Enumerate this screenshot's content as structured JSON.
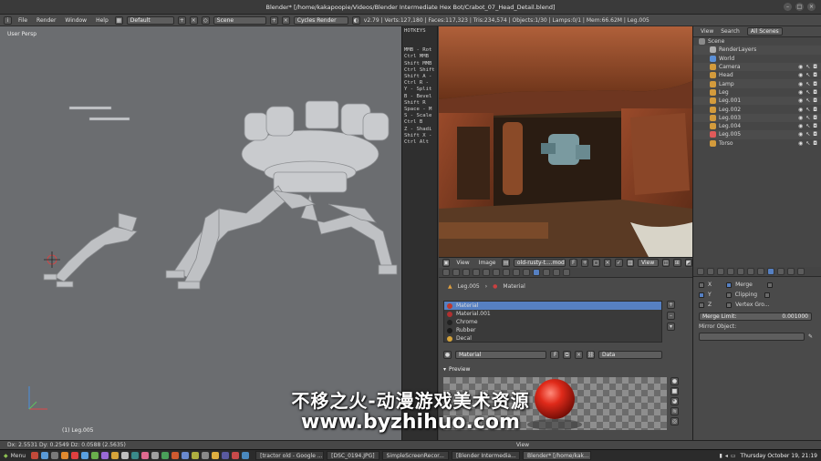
{
  "window": {
    "title": "Blender* [/home/kakapoopie/Videos/Blender Intermediate Hex Bot/Crabot_07_Head_Detail.blend]"
  },
  "infobar": {
    "menus": [
      "File",
      "Render",
      "Window",
      "Help"
    ],
    "layout": "Default",
    "scene": "Scene",
    "engine": "Cycles Render",
    "stats": "v2.79 | Verts:127,180 | Faces:117,323 | Tris:234,574 | Objects:1/30 | Lamps:0/1 | Mem:66.62M | Leg.005"
  },
  "viewport": {
    "view_label": "User Persp",
    "object_label": "(1) Leg.005"
  },
  "hotkeys": {
    "title": "HOTKEYS",
    "lines": [
      "MMB - Rot",
      "Ctrl MMB",
      "Shift MMB",
      "Ctrl Shift",
      "Shift A -",
      "Ctrl R -",
      "Y - Split",
      "B - Bevel",
      "Shift R",
      "Space - M",
      "S - Scale",
      "Ctrl B",
      "Z - Shadi",
      "Shift X -",
      "Ctrl Alt"
    ]
  },
  "image_header": {
    "menus": [
      "View",
      "Image"
    ],
    "image_name": "old-rusty-t....model.jpg",
    "view_btn": "View"
  },
  "outliner": {
    "tabs": [
      "View",
      "Search",
      "All Scenes"
    ],
    "items": [
      {
        "label": "Scene",
        "indent": 0,
        "color": "#8a8a8a",
        "vis": false
      },
      {
        "label": "RenderLayers",
        "indent": 1,
        "color": "#b0b0b0",
        "vis": false
      },
      {
        "label": "World",
        "indent": 1,
        "color": "#5b8fd6",
        "vis": false
      },
      {
        "label": "Camera",
        "indent": 1,
        "color": "#d39b3c",
        "vis": true
      },
      {
        "label": "Head",
        "indent": 1,
        "color": "#d39b3c",
        "vis": true
      },
      {
        "label": "Lamp",
        "indent": 1,
        "color": "#d39b3c",
        "vis": true
      },
      {
        "label": "Leg",
        "indent": 1,
        "color": "#d39b3c",
        "vis": true
      },
      {
        "label": "Leg.001",
        "indent": 1,
        "color": "#d39b3c",
        "vis": true
      },
      {
        "label": "Leg.002",
        "indent": 1,
        "color": "#d39b3c",
        "vis": true
      },
      {
        "label": "Leg.003",
        "indent": 1,
        "color": "#d39b3c",
        "vis": true
      },
      {
        "label": "Leg.004",
        "indent": 1,
        "color": "#d39b3c",
        "vis": true
      },
      {
        "label": "Leg.005",
        "indent": 1,
        "color": "#e05a5a",
        "vis": true
      },
      {
        "label": "Torso",
        "indent": 1,
        "color": "#d39b3c",
        "vis": true
      }
    ]
  },
  "material_props": {
    "object": "Leg.005",
    "context": "Material",
    "slots": [
      {
        "name": "Material",
        "color": "#c0392b",
        "selected": true
      },
      {
        "name": "Material.001",
        "color": "#b03030",
        "selected": false
      },
      {
        "name": "Chrome",
        "color": "#222222",
        "selected": false
      },
      {
        "name": "Rubber",
        "color": "#1a1a1a",
        "selected": false
      },
      {
        "name": "Decal",
        "color": "#d6a43a",
        "selected": false
      }
    ],
    "material_field": "Material",
    "f_label": "F",
    "data_label": "Data",
    "preview_label": "Preview"
  },
  "modifier_props": {
    "options": [
      {
        "label": "Merge",
        "on": true
      },
      {
        "label": "Clipping",
        "on": false
      },
      {
        "label": "Vertex Gro...",
        "on": false
      }
    ],
    "axis_labels": [
      "X",
      "Y",
      "Z"
    ],
    "merge_limit_label": "Merge Limit:",
    "merge_limit_value": "0.001000",
    "mirror_object_label": "Mirror Object:"
  },
  "statusbar": {
    "delta": "Dx: 2.5531  Dy: 0.2549  Dz: 0.0588 (2.5635)",
    "view_label": "View"
  },
  "taskbar": {
    "menu_label": "Menu",
    "tasks": [
      "[tractor old - Google ...",
      "[DSC_0194.JPG]",
      "SimpleScreenRecor...",
      "[Blender Intermedia...",
      "Blender* [/home/kak..."
    ],
    "clock": "Thursday October 19, 21:19"
  },
  "watermark": {
    "line1": "不移之火-动漫游戏美术资源",
    "line2": "www.byzhihuo.com"
  },
  "colors": {
    "selection": "#5680c2",
    "viewport_bg": "#6b6d70"
  }
}
